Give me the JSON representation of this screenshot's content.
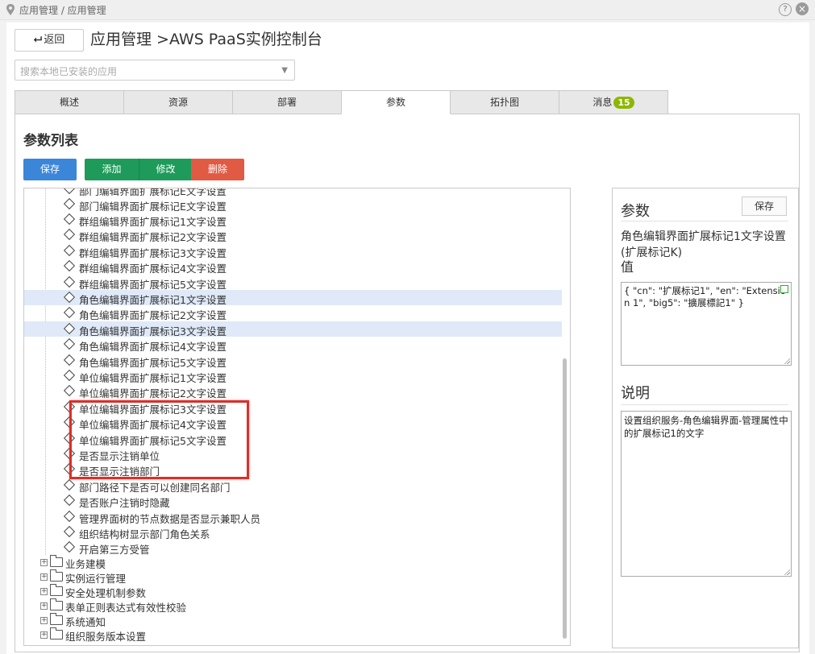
{
  "topbar": {
    "breadcrumb": "应用管理 / 应用管理",
    "help": "?",
    "close": "×"
  },
  "header": {
    "back_label": "返回",
    "title": "应用管理 >AWS PaaS实例控制台"
  },
  "search": {
    "placeholder": "搜索本地已安装的应用"
  },
  "tabs": [
    {
      "label": "概述"
    },
    {
      "label": "资源"
    },
    {
      "label": "部署"
    },
    {
      "label": "参数",
      "active": true
    },
    {
      "label": "拓扑图"
    },
    {
      "label": "消息",
      "badge": "15"
    }
  ],
  "section": {
    "title": "参数列表"
  },
  "toolbar": {
    "save": "保存",
    "add": "添加",
    "edit": "修改",
    "delete": "删除"
  },
  "tree": {
    "items": [
      "部门编辑界面扩展标记E文字设置",
      "部门编辑界面扩展标记E文字设置",
      "群组编辑界面扩展标记1文字设置",
      "群组编辑界面扩展标记2文字设置",
      "群组编辑界面扩展标记3文字设置",
      "群组编辑界面扩展标记4文字设置",
      "群组编辑界面扩展标记5文字设置",
      "角色编辑界面扩展标记1文字设置",
      "角色编辑界面扩展标记2文字设置",
      "角色编辑界面扩展标记3文字设置",
      "角色编辑界面扩展标记4文字设置",
      "角色编辑界面扩展标记5文字设置",
      "单位编辑界面扩展标记1文字设置",
      "单位编辑界面扩展标记2文字设置",
      "单位编辑界面扩展标记3文字设置",
      "单位编辑界面扩展标记4文字设置",
      "单位编辑界面扩展标记5文字设置",
      "是否显示注销单位",
      "是否显示注销部门",
      "部门路径下是否可以创建同名部门",
      "是否账户注销时隐藏",
      "管理界面树的节点数据是否显示兼职人员",
      "组织结构树显示部门角色关系",
      "开启第三方受管"
    ],
    "folders": [
      "业务建模",
      "实例运行管理",
      "安全处理机制参数",
      "表单正则表达式有效性校验",
      "系统通知",
      "组织服务版本设置"
    ]
  },
  "side": {
    "title": "参数",
    "save": "保存",
    "param_name": "角色编辑界面扩展标记1文字设置(扩展标记K)",
    "value_label": "值",
    "value": "{ \"cn\": \"扩展标记1\", \"en\": \"Extension 1\", \"big5\": \"擴展標記1\" }",
    "desc_label": "说明",
    "desc": "设置组织服务-角色编辑界面-管理属性中的扩展标记1的文字"
  }
}
